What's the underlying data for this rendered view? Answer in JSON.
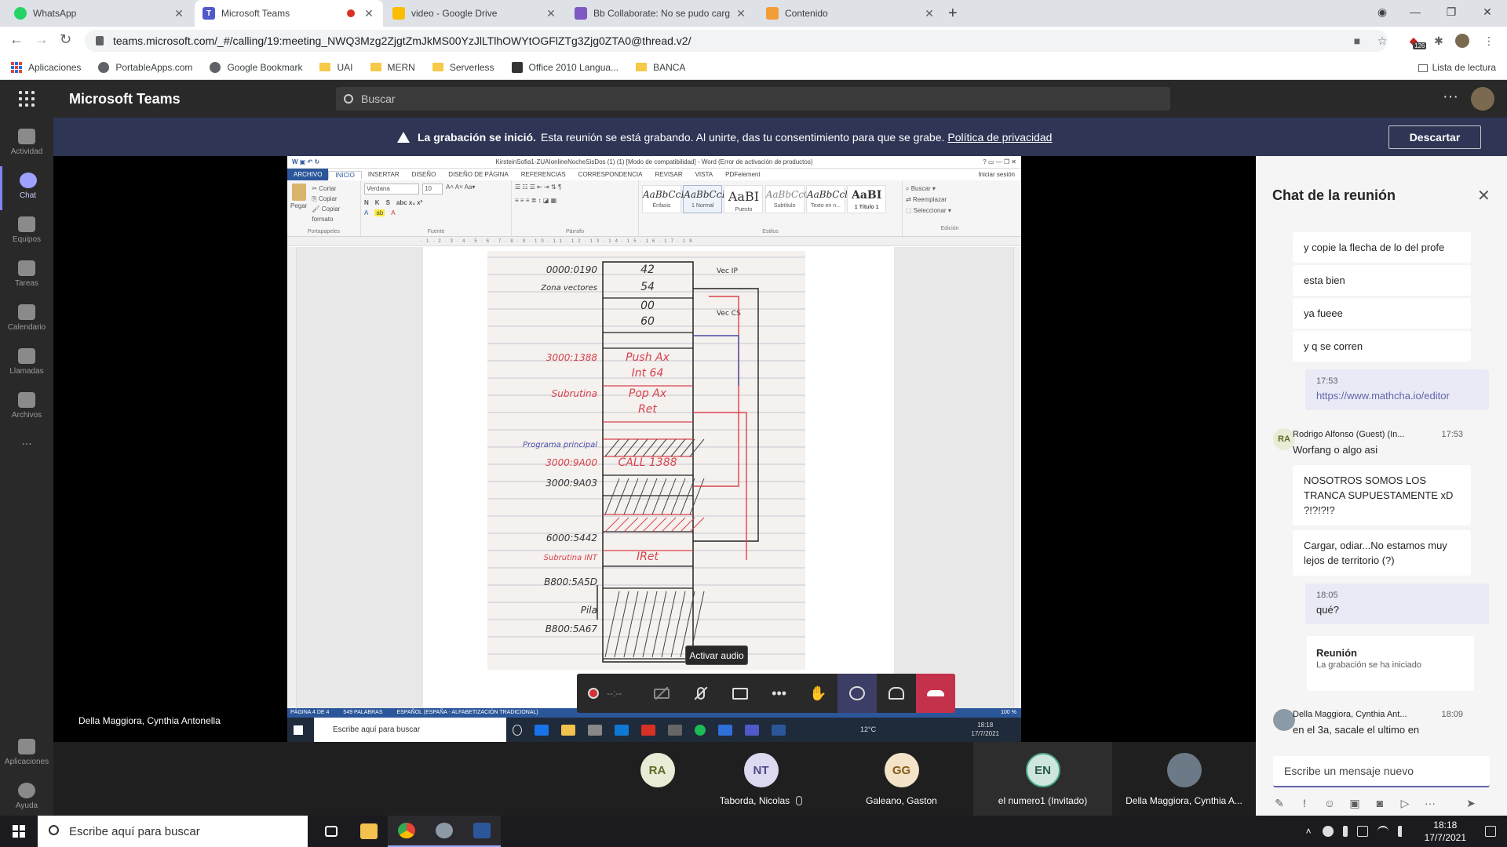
{
  "browser": {
    "tabs": [
      {
        "title": "WhatsApp",
        "icon": "whatsapp-icon",
        "color": "#25d366"
      },
      {
        "title": "Microsoft Teams",
        "icon": "teams-icon",
        "color": "#5059c9",
        "active": true,
        "recording": true
      },
      {
        "title": "video - Google Drive",
        "icon": "google-drive-icon",
        "color": "#fbbc04"
      },
      {
        "title": "Bb Collaborate: No se pudo carg",
        "icon": "collaborate-icon",
        "color": "#7e57c2"
      },
      {
        "title": "Contenido",
        "icon": "pencil-icon",
        "color": "#f29d38"
      }
    ],
    "url": "teams.microsoft.com/_#/calling/19:meeting_NWQ3Mzg2ZjgtZmJkMS00YzJlLTlhOWYtOGFlZTg3Zjg0ZTA0@thread.v2/",
    "extension_badge": "126",
    "bookmarks": [
      "Aplicaciones",
      "PortableApps.com",
      "Google Bookmark",
      "UAI",
      "MERN",
      "Serverless",
      "Office 2010 Langua...",
      "BANCA"
    ],
    "reading_list": "Lista de lectura"
  },
  "teams": {
    "app_name": "Microsoft Teams",
    "search_placeholder": "Buscar",
    "rail": [
      {
        "label": "Actividad",
        "icon": "bell-icon"
      },
      {
        "label": "Chat",
        "icon": "chat-icon",
        "active": true
      },
      {
        "label": "Equipos",
        "icon": "teams-group-icon"
      },
      {
        "label": "Tareas",
        "icon": "backpack-icon"
      },
      {
        "label": "Calendario",
        "icon": "calendar-icon"
      },
      {
        "label": "Llamadas",
        "icon": "phone-icon"
      },
      {
        "label": "Archivos",
        "icon": "file-icon"
      }
    ],
    "rail_more": "...",
    "rail_bottom": [
      {
        "label": "Aplicaciones",
        "icon": "apps-icon"
      },
      {
        "label": "Ayuda",
        "icon": "help-icon"
      }
    ],
    "banner": {
      "bold": "La grabación se inició.",
      "text": "Esta reunión se está grabando. Al unirte, das tu consentimiento para que se grabe.",
      "link": "Política de privacidad",
      "dismiss": "Descartar"
    },
    "presenter_name": "Della Maggiora, Cynthia Antonella",
    "tooltip": "Activar audio",
    "call_timer": "--:--",
    "participants": [
      {
        "initials": "RA",
        "name": "",
        "color": "#e8ebd5",
        "text_color": "#5b6b2a"
      },
      {
        "initials": "NT",
        "name": "Taborda, Nicolas",
        "color": "#dcdaf0",
        "text_color": "#4f4a86",
        "muted": true
      },
      {
        "initials": "GG",
        "name": "Galeano, Gaston",
        "color": "#f3e3c9",
        "text_color": "#8a5a18"
      },
      {
        "initials": "EN",
        "name": "el numero1 (Invitado)",
        "color": "#cfe6df",
        "text_color": "#2b5a4e"
      },
      {
        "initials": "",
        "name": "Della Maggiora, Cynthia A...",
        "color": "#6b7a86",
        "text_color": "#fff"
      }
    ],
    "chat": {
      "title": "Chat de la reunión",
      "messages": [
        {
          "text": "y copie la flecha de lo del profe"
        },
        {
          "text": "esta bien"
        },
        {
          "text": "ya fueee"
        },
        {
          "text": "y q se corren"
        },
        {
          "time": "17:53",
          "text": "https://www.mathcha.io/editor",
          "self": true
        },
        {
          "sender": "Rodrigo Alfonso (Guest) (In...",
          "time": "17:53",
          "text": "Worfang o algo asi",
          "initials": "RA"
        },
        {
          "text": "NOSOTROS SOMOS LOS TRANCA SUPUESTAMENTE xD ?!?!?!?"
        },
        {
          "text": "Cargar, odiar...No estamos muy lejos de territorio (?)"
        },
        {
          "time": "18:05",
          "text": "qué?",
          "self": true
        },
        {
          "sender": "Della Maggiora, Cynthia Ant...",
          "time": "18:09",
          "text": "en el 3a, sacale el ultimo en"
        }
      ],
      "meeting_card": {
        "title": "Reunión",
        "text": "La grabación se ha iniciado"
      },
      "compose_placeholder": "Escribe un mensaje nuevo"
    }
  },
  "word": {
    "title": "KirsteinSofia1-ZUAIonlineNocheSisDos (1) (1) [Modo de compatibilidad] - Word (Error de activación de productos)",
    "sign_in": "Iniciar sesión",
    "tabs": [
      "ARCHIVO",
      "INICIO",
      "INSERTAR",
      "DISEÑO",
      "DISEÑO DE PÁGINA",
      "REFERENCIAS",
      "CORRESPONDENCIA",
      "REVISAR",
      "VISTA",
      "PDFelement"
    ],
    "clipboard": {
      "paste": "Pegar",
      "cut": "Cortar",
      "copy": "Copiar",
      "format": "Copiar formato",
      "label": "Portapapeles"
    },
    "font": {
      "name": "Verdana",
      "size": "10",
      "label": "Fuente",
      "bold": "N",
      "italic": "K",
      "underline": "S"
    },
    "paragraph_label": "Párrafo",
    "styles": [
      {
        "sample": "AaBbCcI",
        "name": "Énfasis"
      },
      {
        "sample": "AaBbCcI",
        "name": "1 Normal"
      },
      {
        "sample": "AaBI",
        "name": "Puesto"
      },
      {
        "sample": "AaBbCcC",
        "name": "Subtítulo"
      },
      {
        "sample": "AaBbCcl",
        "name": "Texto en n..."
      },
      {
        "sample": "AaBI",
        "name": "1 Título 1"
      }
    ],
    "styles_label": "Estilos",
    "editing": {
      "find": "Buscar",
      "replace": "Reemplazar",
      "select": "Seleccionar",
      "label": "Edición"
    },
    "status": {
      "page": "PÁGINA 4 DE 4",
      "words": "549 PALABRAS",
      "language": "ESPAÑOL (ESPAÑA - ALFABETIZACIÓN TRADICIONAL)",
      "zoom": "100 %"
    },
    "inner_taskbar": {
      "search": "Escribe aquí para buscar",
      "temp": "12°C",
      "time": "18:18",
      "date": "17/7/2021"
    }
  },
  "note": {
    "rows": [
      {
        "addr": "0000:0190",
        "cell": "42",
        "color": "#333"
      },
      {
        "addr": "Zona vectores",
        "cell": "54",
        "color": "#333"
      },
      {
        "addr": "",
        "cell": "00",
        "color": "#333"
      },
      {
        "addr": "",
        "cell": "60",
        "color": "#333"
      },
      {
        "addr": "3000:1388",
        "cell": "Push Ax",
        "color": "#d9434f"
      },
      {
        "addr": "",
        "cell": "Int 64",
        "color": "#d9434f"
      },
      {
        "addr": "Subrutina",
        "cell": "Pop Ax",
        "color": "#d9434f"
      },
      {
        "addr": "",
        "cell": "Ret",
        "color": "#d9434f"
      },
      {
        "addr": "Programa principal",
        "cell": "",
        "color": "#4a4ea8"
      },
      {
        "addr": "3000:9A00",
        "cell": "CALL 1388",
        "color": "#d9434f"
      },
      {
        "addr": "3000:9A03",
        "cell": "",
        "color": "#333"
      },
      {
        "addr": "6000:5442",
        "cell": "",
        "color": "#333"
      },
      {
        "addr": "Subrutina INT",
        "cell": "IRet",
        "color": "#d9434f"
      },
      {
        "addr": "B800:5A5D",
        "cell": "",
        "color": "#333"
      },
      {
        "addr": "Pila",
        "cell": "",
        "color": "#333"
      },
      {
        "addr": "B800:5A67",
        "cell": "",
        "color": "#333"
      }
    ],
    "vec_ip": "Vec IP",
    "vec_cs": "Vec CS"
  },
  "taskbar": {
    "search": "Escribe aquí para buscar",
    "time": "18:18",
    "date": "17/7/2021",
    "apps": [
      {
        "name": "task-view-icon",
        "color": "#ffffff"
      },
      {
        "name": "file-explorer-icon",
        "color": "#f2c14e"
      },
      {
        "name": "chrome-icon",
        "color": "#4285f4"
      },
      {
        "name": "app-icon",
        "color": "#8e9aa6"
      },
      {
        "name": "word-icon",
        "color": "#2b579a"
      }
    ]
  }
}
